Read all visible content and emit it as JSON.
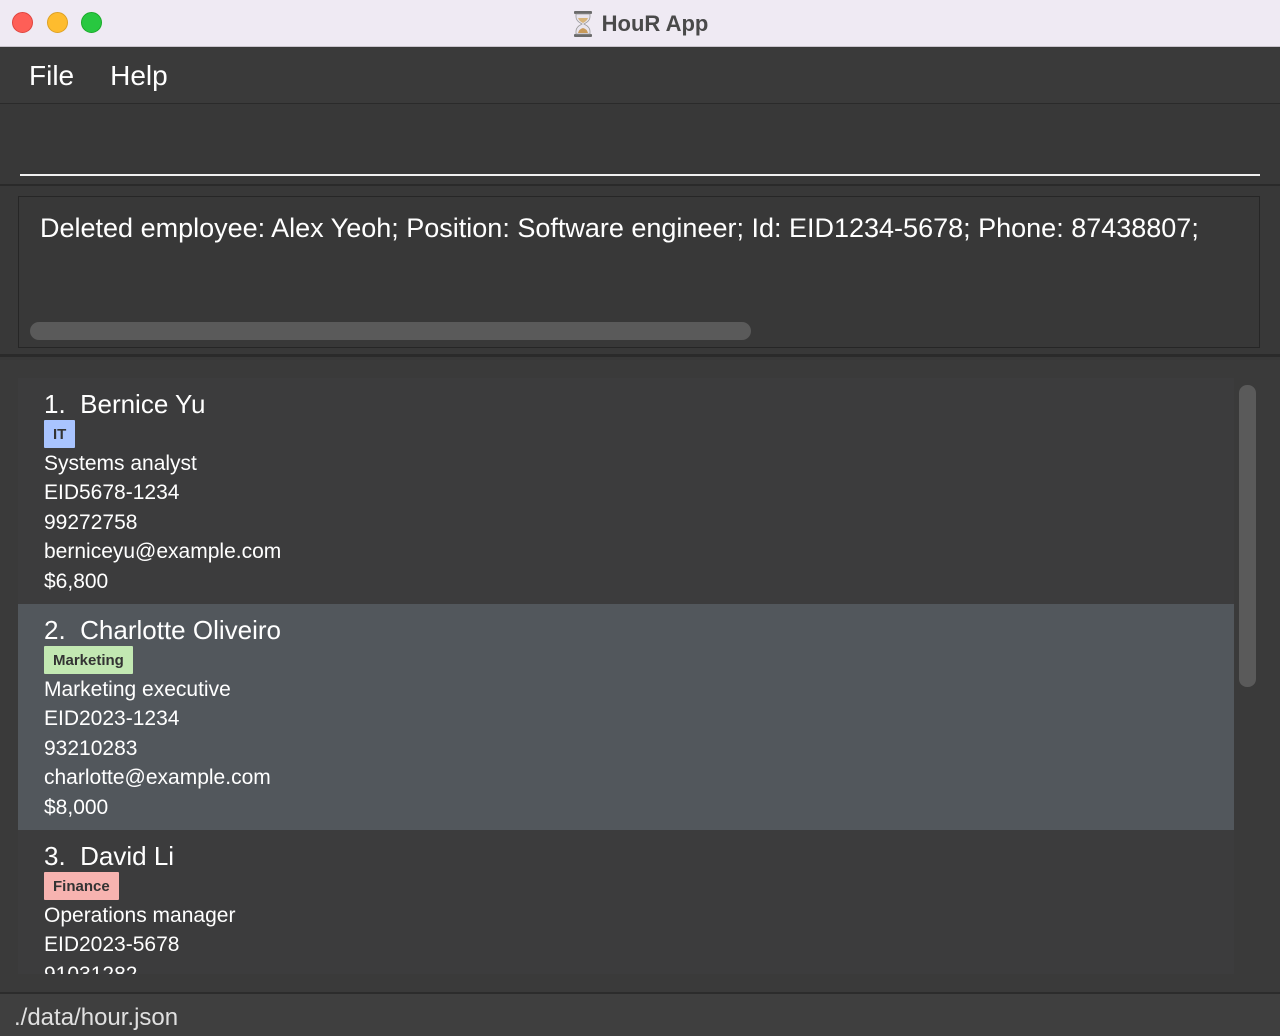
{
  "window": {
    "title": "HouR App"
  },
  "menu": {
    "file": "File",
    "help": "Help"
  },
  "command": {
    "value": "",
    "placeholder": ""
  },
  "result": {
    "text": "Deleted employee: Alex Yeoh; Position: Software engineer; Id: EID1234-5678; Phone: 87438807;"
  },
  "employees": [
    {
      "index": "1.",
      "name": "Bernice Yu",
      "tag": "IT",
      "tag_color": "#a9c4ff",
      "position": "Systems analyst",
      "id": "EID5678-1234",
      "phone": "99272758",
      "email": "berniceyu@example.com",
      "salary": "$6,800"
    },
    {
      "index": "2.",
      "name": "Charlotte Oliveiro",
      "tag": "Marketing",
      "tag_color": "#c2e8b2",
      "position": "Marketing executive",
      "id": "EID2023-1234",
      "phone": "93210283",
      "email": "charlotte@example.com",
      "salary": "$8,000"
    },
    {
      "index": "3.",
      "name": "David Li",
      "tag": "Finance",
      "tag_color": "#f7b3b0",
      "position": "Operations manager",
      "id": "EID2023-5678",
      "phone": "91031282",
      "email": "",
      "salary": ""
    }
  ],
  "status": {
    "path": "./data/hour.json"
  },
  "colors": {
    "titlebar": "#efeaf3",
    "background": "#383838",
    "selected_card": "#52575c"
  }
}
